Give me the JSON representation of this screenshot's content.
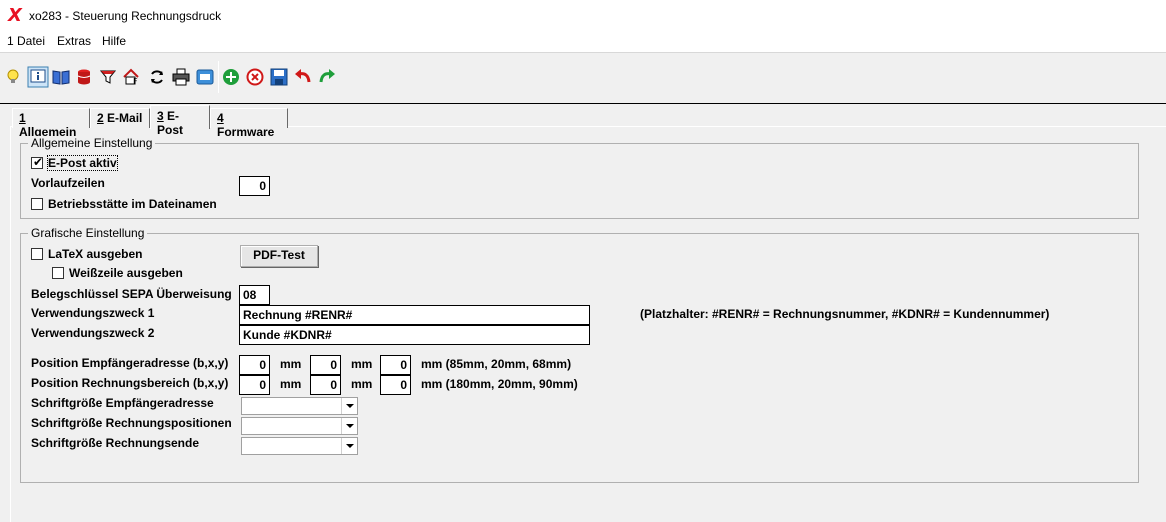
{
  "window": {
    "title": "xo283 - Steuerung Rechnungsdruck",
    "logo": "X"
  },
  "menu": {
    "items": [
      "1 Datei",
      "Extras",
      "Hilfe"
    ]
  },
  "toolbar": {
    "icons": [
      "lightbulb-icon",
      "info-icon",
      "book-icon",
      "database-icon",
      "filter-icon",
      "home-document-icon",
      "refresh-icon",
      "print-icon",
      "window-icon",
      "add-icon",
      "delete-icon",
      "save-icon",
      "undo-icon",
      "redo-icon"
    ]
  },
  "tabs": [
    {
      "key": "1",
      "label": "Allgemein",
      "active": false
    },
    {
      "key": "2",
      "label": "E-Mail",
      "active": false
    },
    {
      "key": "3",
      "label": "E-Post",
      "active": true
    },
    {
      "key": "4",
      "label": "Formware",
      "active": false
    }
  ],
  "general": {
    "title": "Allgemeine Einstellung",
    "epost_active": {
      "label": "E-Post aktiv",
      "checked": true
    },
    "lead_lines": {
      "label": "Vorlaufzeilen",
      "value": "0"
    },
    "site_in_filename": {
      "label": "Betriebsstätte im Dateinamen",
      "checked": false
    }
  },
  "graphic": {
    "title": "Grafische Einstellung",
    "latex": {
      "label": "LaTeX ausgeben",
      "checked": false
    },
    "pdf_test_label": "PDF-Test",
    "blank_line": {
      "label": "Weißzeile ausgeben",
      "checked": false
    },
    "sepa_key": {
      "label": "Belegschlüssel SEPA Überweisung",
      "value": "08"
    },
    "purpose1": {
      "label": "Verwendungszweck 1",
      "value": "Rechnung #RENR#"
    },
    "purpose2": {
      "label": "Verwendungszweck 2",
      "value": "Kunde #KDNR#"
    },
    "placeholder_hint": "(Platzhalter: #RENR# = Rechnungsnummer, #KDNR# = Kundennummer)",
    "recipient_pos": {
      "label": "Position Empfängeradresse (b,x,y)",
      "b": "0",
      "x": "0",
      "y": "0",
      "unit": "mm",
      "hint": "mm (85mm, 20mm, 68mm)"
    },
    "invoice_pos": {
      "label": "Position Rechnungsbereich (b,x,y)",
      "b": "0",
      "x": "0",
      "y": "0",
      "unit": "mm",
      "hint": "mm (180mm, 20mm, 90mm)"
    },
    "font_recipient": {
      "label": "Schriftgröße Empfängeradresse",
      "value": ""
    },
    "font_positions": {
      "label": "Schriftgröße Rechnungspositionen",
      "value": ""
    },
    "font_end": {
      "label": "Schriftgröße Rechnungsende",
      "value": ""
    }
  }
}
